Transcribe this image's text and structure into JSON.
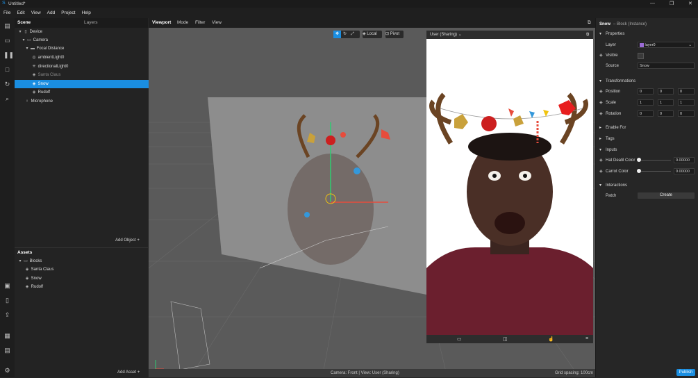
{
  "window": {
    "title": "Untitled*",
    "controls": [
      "—",
      "❐",
      "✕"
    ]
  },
  "menu": [
    "File",
    "Edit",
    "View",
    "Add",
    "Project",
    "Help"
  ],
  "scene": {
    "tabs": [
      "Scene",
      "Layers"
    ],
    "tree": [
      {
        "label": "Device",
        "icon": "▯",
        "toggle": "▾"
      },
      {
        "label": "Camera",
        "icon": "▭",
        "toggle": "▾"
      },
      {
        "label": "Focal Distance",
        "icon": "▬",
        "toggle": "▾"
      },
      {
        "label": "ambientLight0",
        "icon": "◎",
        "toggle": ""
      },
      {
        "label": "directionalLight0",
        "icon": "✳",
        "toggle": ""
      },
      {
        "label": "Santa Claus",
        "icon": "◈",
        "toggle": ""
      },
      {
        "label": "Snow",
        "icon": "◈",
        "toggle": ""
      },
      {
        "label": "Rudolf",
        "icon": "◈",
        "toggle": ""
      },
      {
        "label": "Microphone",
        "icon": "♀",
        "toggle": ""
      }
    ],
    "add_object": "Add Object"
  },
  "assets": {
    "title": "Assets",
    "tree": [
      {
        "label": "Blocks",
        "icon": "▭",
        "toggle": "▾"
      },
      {
        "label": "Santa Claus",
        "icon": "◈",
        "toggle": ""
      },
      {
        "label": "Snow",
        "icon": "◈",
        "toggle": ""
      },
      {
        "label": "Rudolf",
        "icon": "◈",
        "toggle": ""
      }
    ],
    "add_asset": "Add Asset"
  },
  "viewport": {
    "tabs": [
      "Viewport",
      "Mode",
      "Filter",
      "View"
    ],
    "tools": {
      "local": "Local",
      "pivot": "Pivot"
    },
    "status_left": "Camera: Front | View: User (Sharing)",
    "status_right": "Grid spacing: 100cm"
  },
  "simulator": {
    "device_label": "User (Sharing)"
  },
  "properties": {
    "title": "Snow",
    "subtitle": "– Block (Instance)",
    "sections": {
      "properties": "Properties",
      "transformations": "Transformations",
      "enable_for": "Enable For",
      "tags": "Tags",
      "inputs": "Inputs",
      "interactions": "Interactions"
    },
    "layer_label": "Layer",
    "layer_value": "layer0",
    "visible_label": "Visible",
    "source_label": "Source",
    "source_value": "Snow",
    "position_label": "Position",
    "position": [
      "0",
      "0",
      "0"
    ],
    "scale_label": "Scale",
    "scale": [
      "1",
      "1",
      "1"
    ],
    "rotation_label": "Rotation",
    "rotation": [
      "0",
      "0",
      "0"
    ],
    "hat_label": "Hat Deatil Color",
    "hat_value": "0.00000",
    "hat_level": 0,
    "carrot_label": "Carrot Color",
    "carrot_value": "0.00000",
    "carrot_level": 0,
    "patch_label": "Patch",
    "create_label": "Create",
    "publish_label": "Publish"
  },
  "colors": {
    "accent": "#1a8ee1",
    "layer_swatch": "#9b6bd6"
  }
}
